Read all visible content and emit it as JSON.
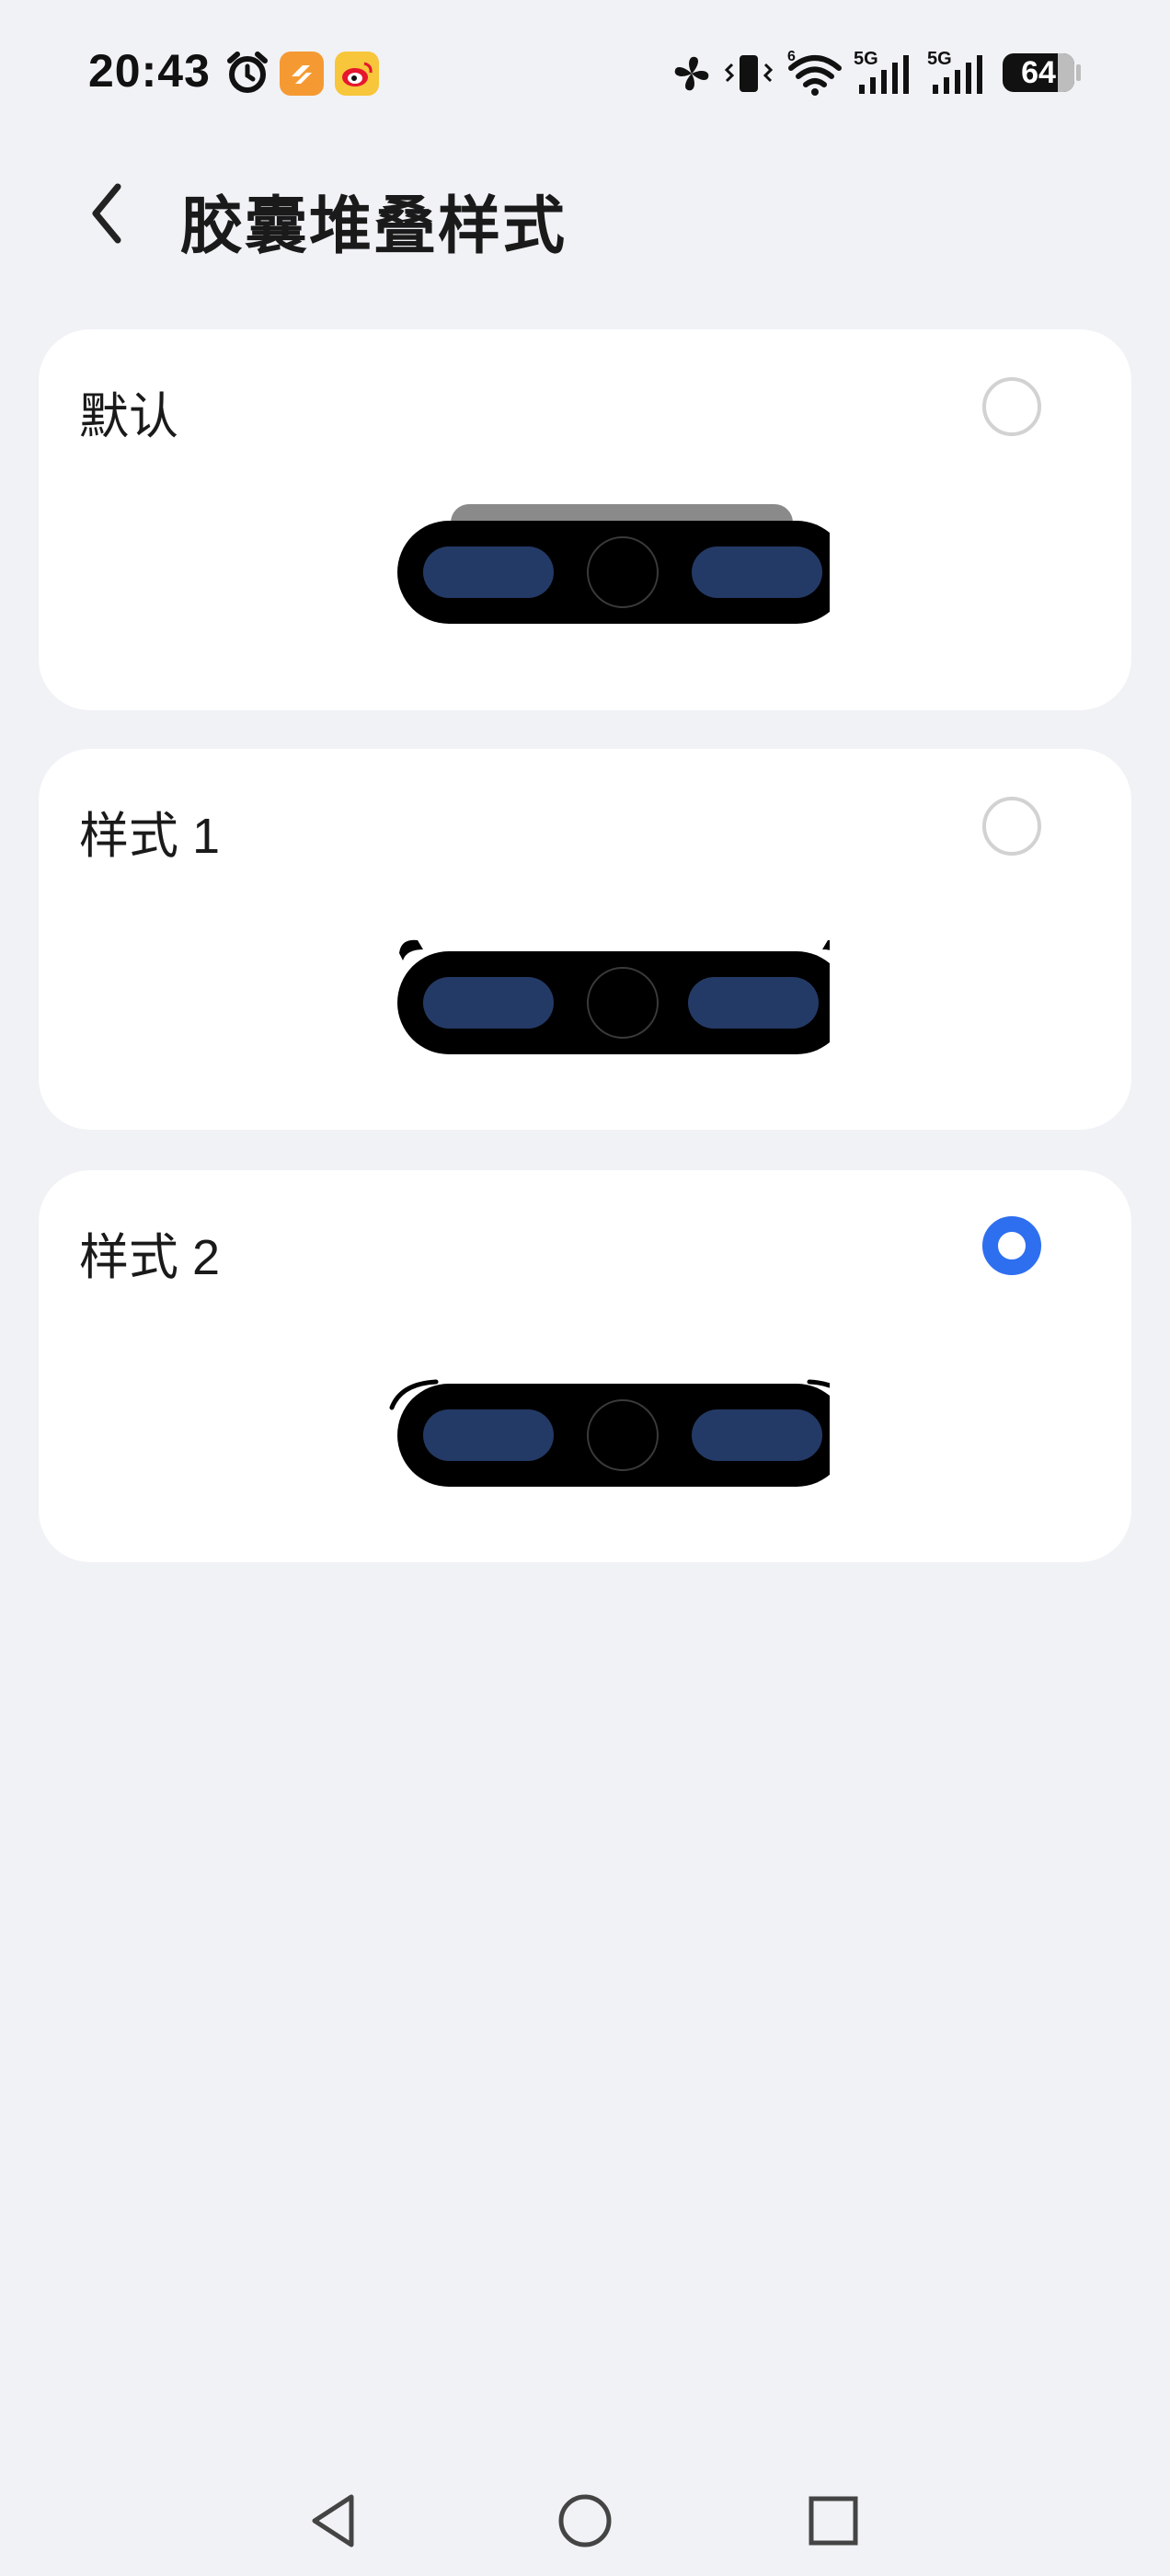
{
  "status_bar": {
    "time": "20:43",
    "battery": "64",
    "icons": [
      "alarm-icon",
      "app-notification-icon",
      "weibo-icon",
      "fan-icon",
      "vibrate-icon",
      "wifi-icon",
      "signal-5g-icon",
      "signal-5g-icon"
    ],
    "network_1": "5G",
    "network_2": "5G",
    "wifi_label": "6"
  },
  "header": {
    "title": "胶囊堆叠样式",
    "back_icon": "back-arrow-icon"
  },
  "options": [
    {
      "label": "默认",
      "selected": false,
      "style": "default"
    },
    {
      "label": "样式 1",
      "selected": false,
      "style": "style1"
    },
    {
      "label": "样式 2",
      "selected": true,
      "style": "style2"
    }
  ],
  "colors": {
    "background": "#f1f2f6",
    "card": "#ffffff",
    "accent": "#2e6ff0",
    "capsule": "#000000",
    "pill": "#243a66"
  },
  "nav_bar": {
    "icons": [
      "nav-back-icon",
      "nav-home-icon",
      "nav-recents-icon"
    ]
  }
}
